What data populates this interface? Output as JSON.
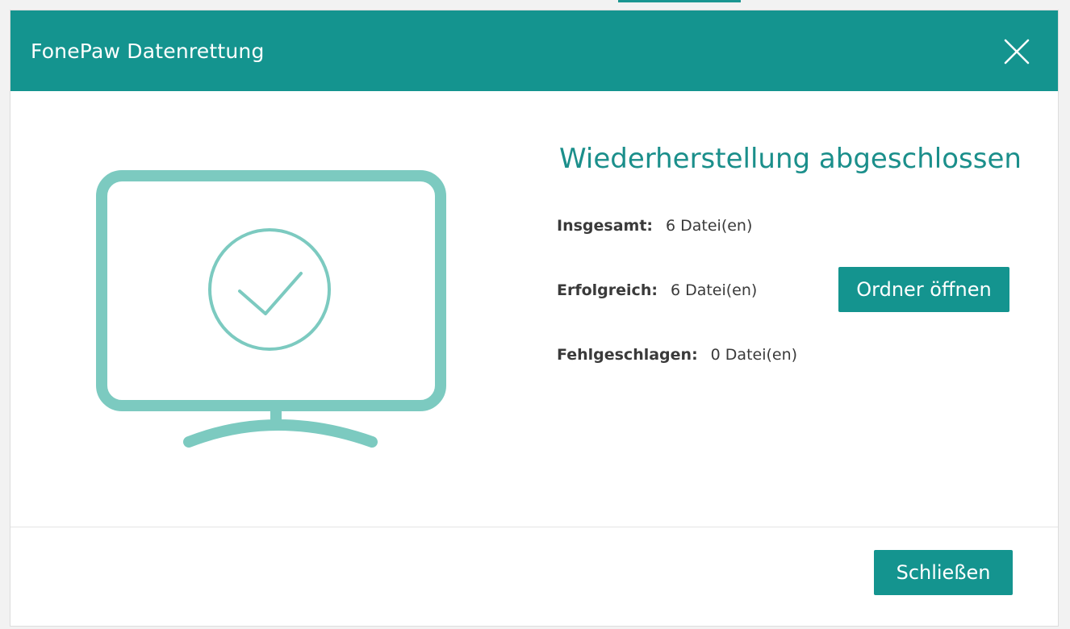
{
  "dialog": {
    "title": "FonePaw Datenrettung",
    "heading": "Wiederherstellung abgeschlossen",
    "stats": [
      {
        "label": "Insgesamt:",
        "value": "6 Datei(en)"
      },
      {
        "label": "Erfolgreich:",
        "value": "6 Datei(en)"
      },
      {
        "label": "Fehlgeschlagen:",
        "value": "0 Datei(en)"
      }
    ],
    "open_folder_label": "Ordner öffnen",
    "close_label": "Schließen"
  },
  "icons": {
    "close": "close-icon",
    "illustration": "monitor-check-icon"
  },
  "colors": {
    "header": "#14948f",
    "accent_text": "#1b8f8b",
    "illustration": "#7ccac0",
    "button": "#14948f"
  }
}
